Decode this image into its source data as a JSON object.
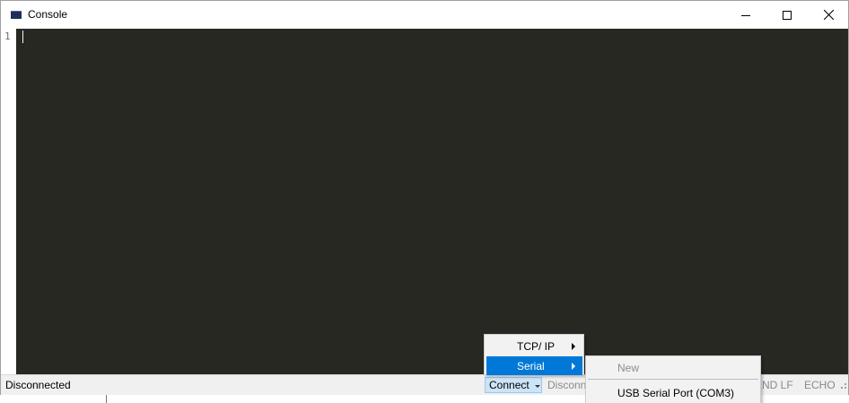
{
  "window": {
    "title": "Console",
    "icon": "console-app-icon"
  },
  "titlebar": {
    "buttons": [
      {
        "name": "minimize",
        "icon": "minimize-icon"
      },
      {
        "name": "maximize",
        "icon": "maximize-icon"
      },
      {
        "name": "close",
        "icon": "close-icon"
      }
    ]
  },
  "editor": {
    "line_numbers": [
      "1"
    ],
    "content": "",
    "background": "#272822"
  },
  "statusbar": {
    "status": "Disconnected",
    "connect_label": "Connect",
    "disconnect_label": "Disconn",
    "send_lf_label": "SEND LF",
    "echo_label": "ECHO"
  },
  "connect_menu": {
    "items": [
      {
        "label": "TCP/ IP",
        "has_submenu": true,
        "selected": false
      },
      {
        "label": "Serial",
        "has_submenu": true,
        "selected": true
      }
    ]
  },
  "serial_submenu": {
    "items": [
      {
        "label": "New",
        "disabled": true
      },
      {
        "label": "USB Serial Port (COM3)",
        "disabled": false
      }
    ]
  },
  "colors": {
    "accent": "#0078d7",
    "connect_bg": "#cce4f7"
  }
}
